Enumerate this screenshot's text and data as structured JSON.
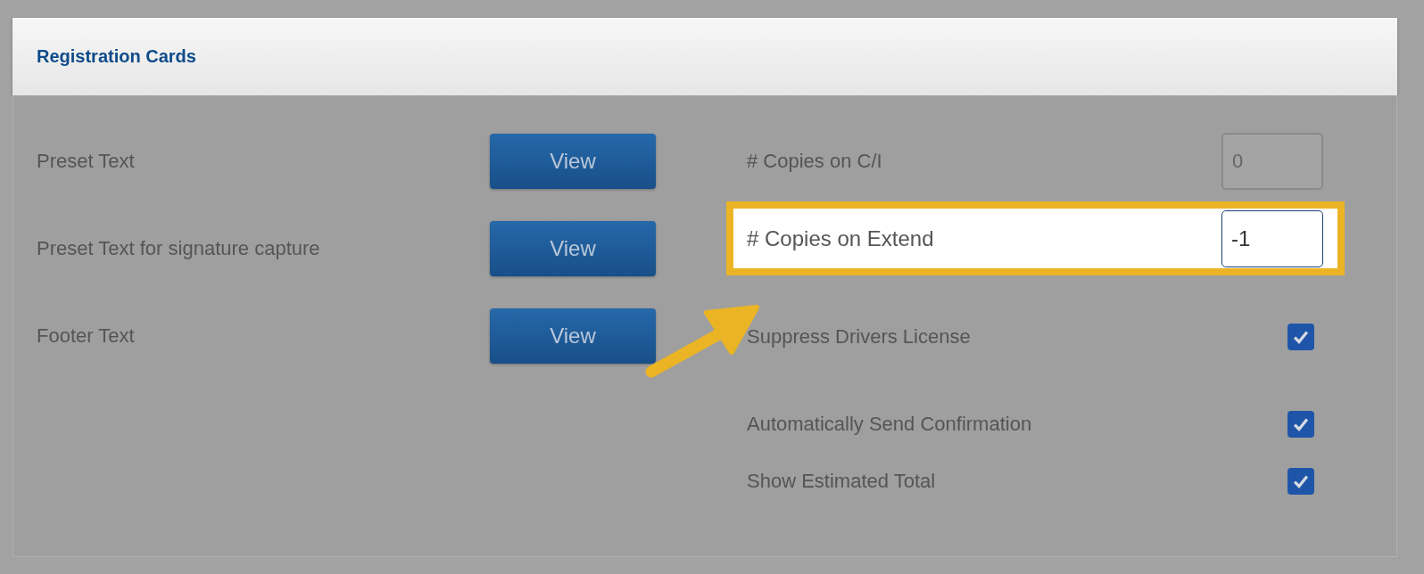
{
  "header": {
    "title": "Registration Cards"
  },
  "preset_items": [
    {
      "label": "Preset Text",
      "button": "View"
    },
    {
      "label": "Preset Text for signature capture",
      "button": "View"
    },
    {
      "label": "Footer Text",
      "button": "View"
    }
  ],
  "settings": [
    {
      "kind": "number",
      "label": "# Copies on C/I",
      "value": "0",
      "highlighted": false
    },
    {
      "kind": "number",
      "label": "# Copies on Extend",
      "value": "-1",
      "highlighted": true
    },
    {
      "kind": "checkbox",
      "label": "Suppress Drivers License",
      "checked": true
    },
    {
      "kind": "checkbox",
      "label": "Automatically Send Confirmation",
      "checked": true
    },
    {
      "kind": "checkbox",
      "label": "Show Estimated Total",
      "checked": true
    }
  ]
}
